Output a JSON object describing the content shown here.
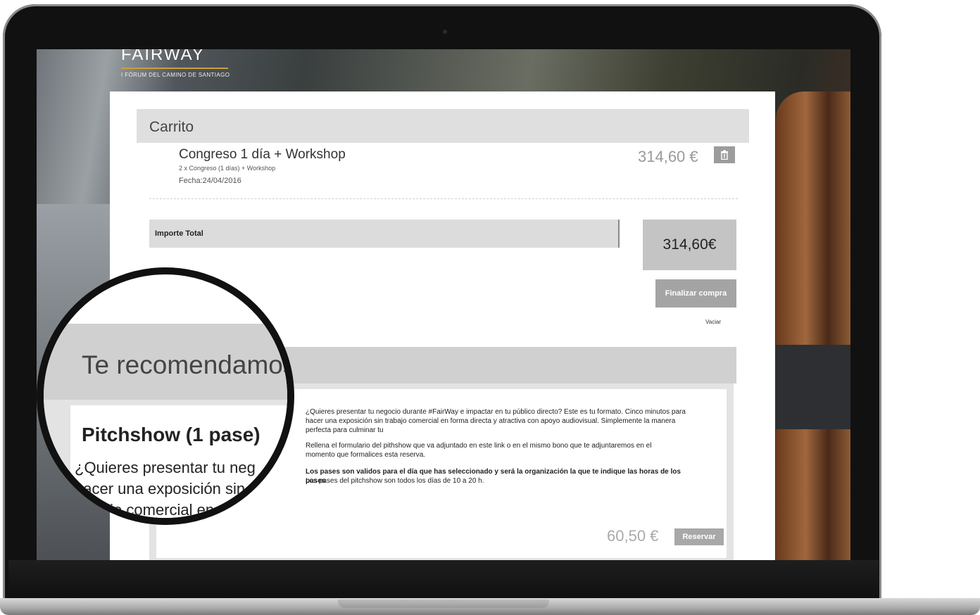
{
  "brand": {
    "name": "FAIRWAY",
    "subtitle": "I FÓRUM DEL CAMINO DE SANTIAGO"
  },
  "cart": {
    "title": "Carrito",
    "item": {
      "name": "Congreso 1 día + Workshop",
      "detail": "2 x Congreso (1 días) + Workshop",
      "date": "Fecha:24/04/2016",
      "price": "314,60 €",
      "delete_icon": "trash-icon"
    },
    "total_label": "Importe Total",
    "total_value": "314,60€",
    "checkout_label": "Finalizar compra",
    "empty_label": "Vaciar"
  },
  "recommend": {
    "title": "Te recomendamos",
    "product": {
      "name": "Pitchshow (1 pase)",
      "desc_line1": "¿Quieres presentar tu negocio durante #FairWay e impactar en tu público directo? Este es tu formato. Cinco minutos para",
      "desc_line2": "hacer una exposición sin trabajo comercial en forma directa y atractiva con apoyo audiovisual. Simplemente la manera perfecta para culminar tu",
      "desc_line3": "Rellena el formulario del pithshow que va adjuntado en este link o en el mismo bono que te adjuntaremos en el",
      "desc_line4": "momento que formalices esta reserva.",
      "desc_bold": "Los pases son validos para el día que has seleccionado y será la organización la que te indique las horas de los pases",
      "desc_line5": "Los pases del pitchshow son todos los días de 10 a 20 h.",
      "price": "60,50 €",
      "reserve_label": "Reservar"
    }
  },
  "magnifier": {
    "title": "Te recomendamos",
    "product_name": "Pitchshow (1 pase)",
    "line1": "¿Quieres presentar tu neg",
    "line2": "hacer una exposición sin",
    "line3": "trabajo comercial en"
  }
}
